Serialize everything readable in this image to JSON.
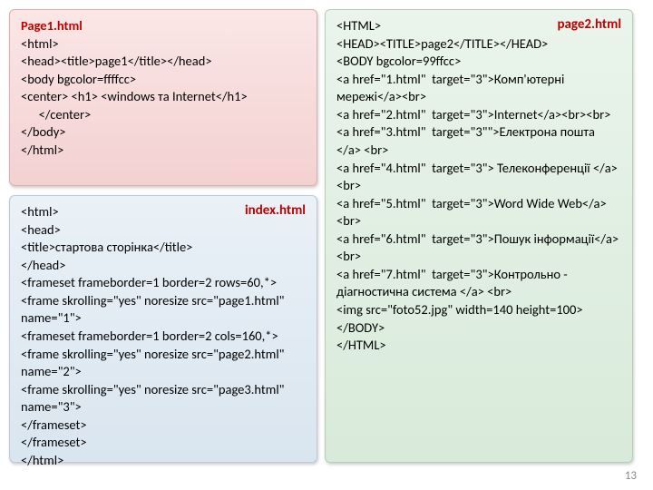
{
  "page1": {
    "label": "Page1.html",
    "code": "<html>\n<head><title>page1</title></head>\n<body bgcolor=ffffcc>\n<center> <h1> <windows та Internet</h1>\n      </center>\n</body>\n</html>"
  },
  "index": {
    "label": "index.html",
    "code": "<html>\n<head>\n<title>стартова сторінка</title>\n</head>\n<frameset frameborder=1 border=2 rows=60,*>\n<frame skrolling=\"yes\" noresize src=\"page1.html\" name=\"1\">\n<frameset frameborder=1 border=2 cols=160,*>\n<frame skrolling=\"yes\" noresize src=\"page2.html\" name=\"2\">\n<frame skrolling=\"yes\" noresize src=\"page3.html\" name=\"3\">\n</frameset>\n</frameset>\n</html>"
  },
  "page2": {
    "label": "page2.html",
    "code": "<HTML>\n<HEAD><TITLE>page2</TITLE></HEAD>\n<BODY bgcolor=99ffcc>\n<a href=\"1.html\"  target=\"3\">Комп'ютерні мережі</a><br>\n<a href=\"2.html\"  target=\"3\">Internet</a><br><br>\n<a href=\"3.html\"  target=\"3\"\">Електрона пошта </a> <br>\n<a href=\"4.html\"  target=\"3\"> Телеконференції </a> <br>\n<a href=\"5.html\"  target=\"3\">Word Wide Web</a> <br>\n<a href=\"6.html\"  target=\"3\">Пошук інформації</a> <br>\n<a href=\"7.html\"  target=\"3\">Контрольно - діагностична система </a> <br>\n<img src=\"foto52.jpg\" width=140 height=100>\n</BODY>\n</HTML>"
  },
  "pagenum": "13"
}
